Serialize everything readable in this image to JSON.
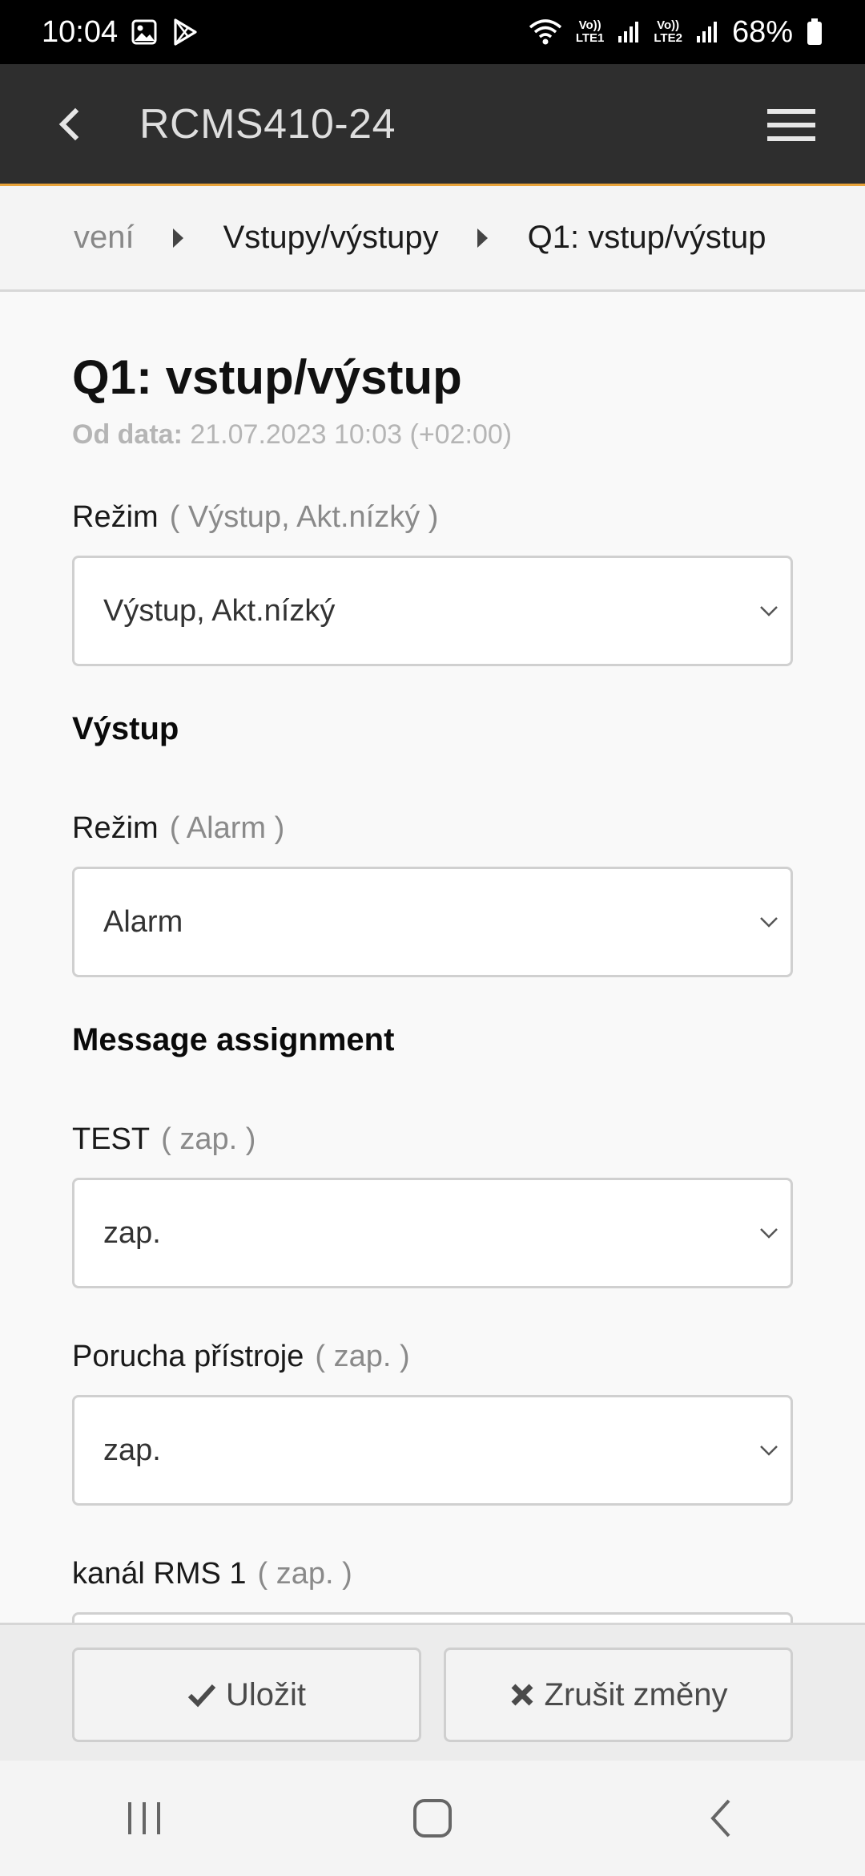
{
  "status_bar": {
    "time": "10:04",
    "battery": "68%",
    "sim1": "LTE1",
    "sim2": "LTE2",
    "volte": "Vo))"
  },
  "app_bar": {
    "title": "RCMS410-24"
  },
  "breadcrumb": {
    "items": [
      "vení",
      "Vstupy/výstupy",
      "Q1: vstup/výstup"
    ]
  },
  "page": {
    "title": "Q1: vstup/výstup",
    "since_label": "Od data:",
    "since_value": "21.07.2023 10:03 (+02:00)"
  },
  "fields": {
    "mode": {
      "label": "Režim",
      "hint": "( Výstup, Akt.nízký )",
      "value": "Výstup, Akt.nízký"
    },
    "output_section": "Výstup",
    "output_mode": {
      "label": "Režim",
      "hint": "( Alarm )",
      "value": "Alarm"
    },
    "message_section": "Message assignment",
    "test": {
      "label": "TEST",
      "hint": "( zap. )",
      "value": "zap."
    },
    "device_fault": {
      "label": "Porucha přístroje",
      "hint": "( zap. )",
      "value": "zap."
    },
    "rms1": {
      "label": "kanál RMS 1",
      "hint": "( zap. )"
    }
  },
  "footer": {
    "save_label": "Uložit",
    "cancel_label": "Zrušit změny"
  },
  "colors": {
    "appbar": "#2e2e2e",
    "accent": "#e8a33a"
  }
}
